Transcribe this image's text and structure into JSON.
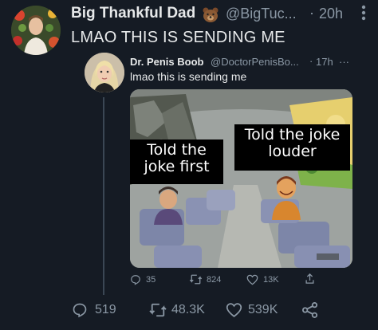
{
  "outer_tweet": {
    "author_name": "Big Thankful Dad",
    "handle": "@BigTuc...",
    "separator": "·",
    "time": "20h",
    "text": "LMAO THIS IS SENDING ME",
    "actions": {
      "replies": "519",
      "retweets": "48.3K",
      "likes": "539K"
    }
  },
  "quoted_tweet": {
    "author_name": "Dr. Penis Boob",
    "handle": "@DoctorPenisBo...",
    "separator": "·",
    "time": "17h",
    "more": "···",
    "text": "lmao this is sending me",
    "meme": {
      "caption_left": "Told the joke first",
      "caption_right": "Told the joke louder"
    },
    "actions": {
      "replies": "35",
      "retweets": "824",
      "likes": "13K"
    }
  },
  "colors": {
    "background": "#151b24",
    "text": "#e7e9ea",
    "secondary": "#8b98a5"
  },
  "icons": [
    "more-icon",
    "reply-icon",
    "retweet-icon",
    "like-icon",
    "share-icon",
    "bear-emoji-icon"
  ]
}
